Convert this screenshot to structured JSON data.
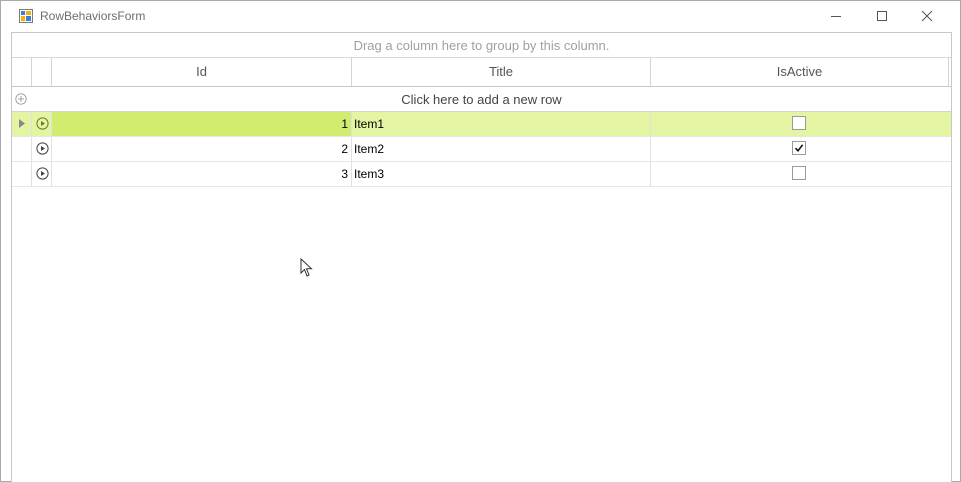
{
  "window": {
    "title": "RowBehaviorsForm"
  },
  "grid": {
    "group_panel_text": "Drag a column here to group by this column.",
    "columns": [
      "Id",
      "Title",
      "IsActive"
    ],
    "new_row_text": "Click here to add a new row",
    "rows": [
      {
        "id": "1",
        "title": "Item1",
        "is_active": false,
        "selected": true
      },
      {
        "id": "2",
        "title": "Item2",
        "is_active": true,
        "selected": false
      },
      {
        "id": "3",
        "title": "Item3",
        "is_active": false,
        "selected": false
      }
    ]
  },
  "colors": {
    "selected_row": "#e3f4a3",
    "selected_cell": "#d2ec6f"
  }
}
